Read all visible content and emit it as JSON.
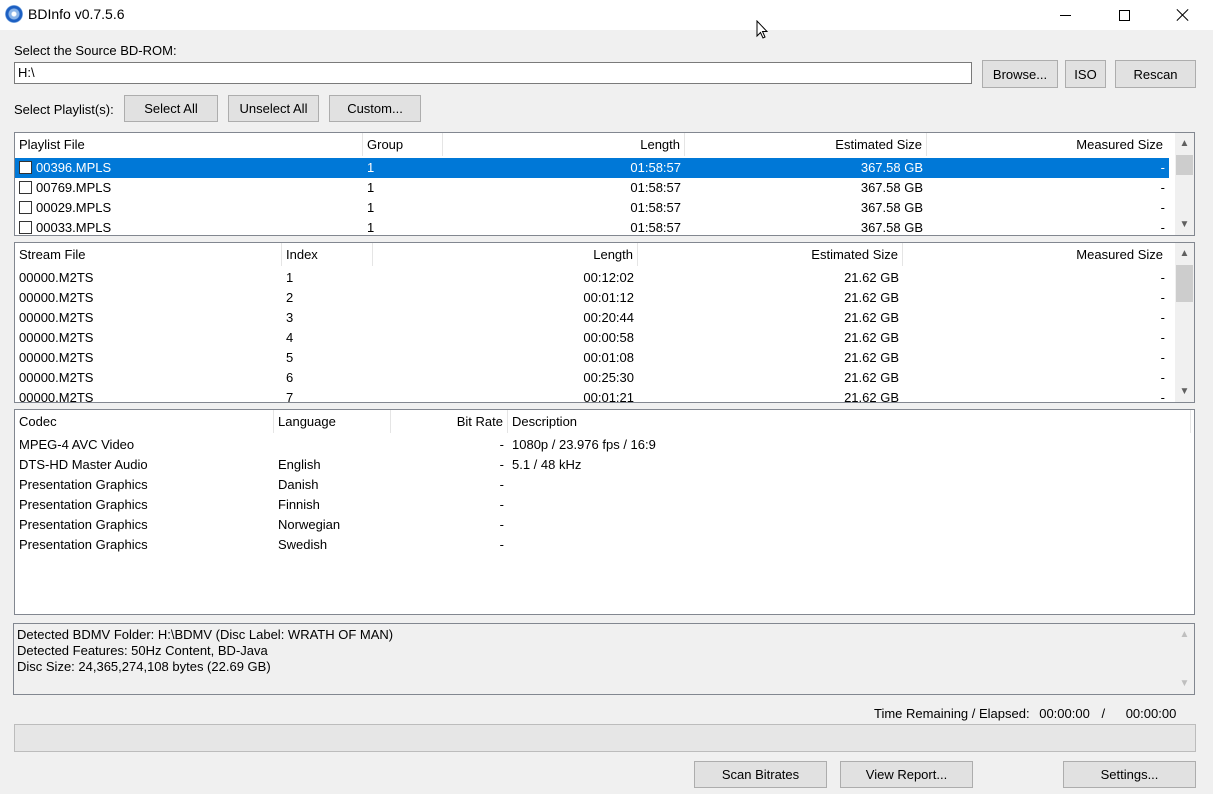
{
  "window": {
    "title": "BDInfo v0.7.5.6"
  },
  "source": {
    "label": "Select the Source BD-ROM:",
    "value": "H:\\",
    "browse_label": "Browse...",
    "iso_label": "ISO",
    "rescan_label": "Rescan"
  },
  "playlist_select": {
    "label": "Select Playlist(s):",
    "select_all_label": "Select All",
    "unselect_all_label": "Unselect All",
    "custom_label": "Custom..."
  },
  "playlists": {
    "columns": [
      "Playlist File",
      "Group",
      "Length",
      "Estimated Size",
      "Measured Size"
    ],
    "rows": [
      {
        "file": "00396.MPLS",
        "group": "1",
        "length": "01:58:57",
        "est": "367.58 GB",
        "meas": "-"
      },
      {
        "file": "00769.MPLS",
        "group": "1",
        "length": "01:58:57",
        "est": "367.58 GB",
        "meas": "-"
      },
      {
        "file": "00029.MPLS",
        "group": "1",
        "length": "01:58:57",
        "est": "367.58 GB",
        "meas": "-"
      },
      {
        "file": "00033.MPLS",
        "group": "1",
        "length": "01:58:57",
        "est": "367.58 GB",
        "meas": "-"
      }
    ]
  },
  "streams": {
    "columns": [
      "Stream File",
      "Index",
      "Length",
      "Estimated Size",
      "Measured Size"
    ],
    "rows": [
      {
        "file": "00000.M2TS",
        "index": "1",
        "length": "00:12:02",
        "est": "21.62 GB",
        "meas": "-"
      },
      {
        "file": "00000.M2TS",
        "index": "2",
        "length": "00:01:12",
        "est": "21.62 GB",
        "meas": "-"
      },
      {
        "file": "00000.M2TS",
        "index": "3",
        "length": "00:20:44",
        "est": "21.62 GB",
        "meas": "-"
      },
      {
        "file": "00000.M2TS",
        "index": "4",
        "length": "00:00:58",
        "est": "21.62 GB",
        "meas": "-"
      },
      {
        "file": "00000.M2TS",
        "index": "5",
        "length": "00:01:08",
        "est": "21.62 GB",
        "meas": "-"
      },
      {
        "file": "00000.M2TS",
        "index": "6",
        "length": "00:25:30",
        "est": "21.62 GB",
        "meas": "-"
      },
      {
        "file": "00000.M2TS",
        "index": "7",
        "length": "00:01:21",
        "est": "21.62 GB",
        "meas": "-"
      }
    ]
  },
  "codecs": {
    "columns": [
      "Codec",
      "Language",
      "Bit Rate",
      "Description"
    ],
    "rows": [
      {
        "codec": "MPEG-4 AVC Video",
        "lang": "",
        "bitrate": "-",
        "desc": "1080p / 23.976 fps / 16:9"
      },
      {
        "codec": "DTS-HD Master Audio",
        "lang": "English",
        "bitrate": "-",
        "desc": "5.1 / 48 kHz"
      },
      {
        "codec": "Presentation Graphics",
        "lang": "Danish",
        "bitrate": "-",
        "desc": ""
      },
      {
        "codec": "Presentation Graphics",
        "lang": "Finnish",
        "bitrate": "-",
        "desc": ""
      },
      {
        "codec": "Presentation Graphics",
        "lang": "Norwegian",
        "bitrate": "-",
        "desc": ""
      },
      {
        "codec": "Presentation Graphics",
        "lang": "Swedish",
        "bitrate": "-",
        "desc": ""
      }
    ]
  },
  "log": {
    "lines": [
      "Detected BDMV Folder: H:\\BDMV (Disc Label: WRATH OF MAN)",
      "Detected Features: 50Hz Content, BD-Java",
      "Disc Size: 24,365,274,108 bytes (22.69 GB)"
    ]
  },
  "time": {
    "label": "Time Remaining / Elapsed:",
    "remaining": "00:00:00",
    "separator": "/",
    "elapsed": "00:00:00"
  },
  "progress": {
    "fraction": 0
  },
  "actions": {
    "scan_bitrates_label": "Scan Bitrates",
    "view_report_label": "View Report...",
    "settings_label": "Settings..."
  },
  "icons": {
    "app": "bluray-disc-icon",
    "minimize": "minimize-icon",
    "maximize": "maximize-icon",
    "close": "close-icon",
    "scroll_up": "chevron-up-icon",
    "scroll_down": "chevron-down-icon"
  },
  "colors": {
    "selection": "#0078d7",
    "background": "#f0f0f0"
  }
}
